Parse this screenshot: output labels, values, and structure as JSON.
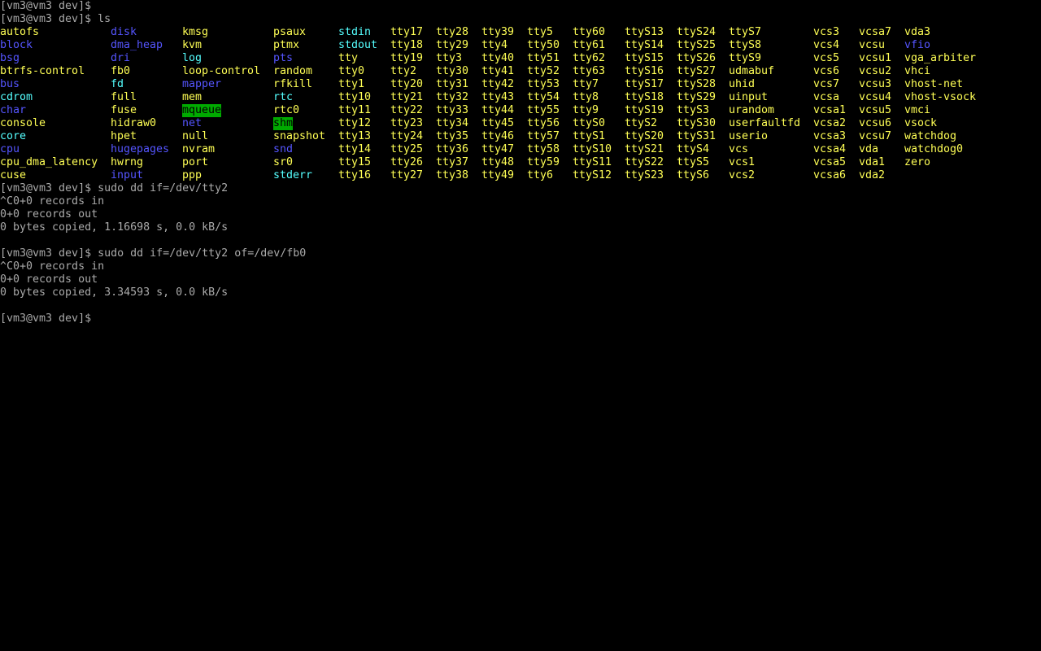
{
  "terminal": {
    "prompt": "[vm3@vm3 dev]$",
    "colors": {
      "background": "#000000",
      "text": "#aaaaaa",
      "device_file": "#ffff55",
      "directory": "#5555ff",
      "symlink": "#55ffff",
      "sticky_dir_highlight": "#00aa00"
    },
    "lines_top": [
      "[vm3@vm3 dev]$",
      "[vm3@vm3 dev]$ ls"
    ],
    "ls_columns": [
      [
        {
          "name": "autofs",
          "kind": "file"
        },
        {
          "name": "block",
          "kind": "dir"
        },
        {
          "name": "bsg",
          "kind": "dir"
        },
        {
          "name": "btrfs-control",
          "kind": "file"
        },
        {
          "name": "bus",
          "kind": "dir"
        },
        {
          "name": "cdrom",
          "kind": "link"
        },
        {
          "name": "char",
          "kind": "dir"
        },
        {
          "name": "console",
          "kind": "file"
        },
        {
          "name": "core",
          "kind": "link"
        },
        {
          "name": "cpu",
          "kind": "dir"
        },
        {
          "name": "cpu_dma_latency",
          "kind": "file"
        },
        {
          "name": "cuse",
          "kind": "file"
        }
      ],
      [
        {
          "name": "disk",
          "kind": "dir"
        },
        {
          "name": "dma_heap",
          "kind": "dir"
        },
        {
          "name": "dri",
          "kind": "dir"
        },
        {
          "name": "fb0",
          "kind": "file"
        },
        {
          "name": "fd",
          "kind": "link"
        },
        {
          "name": "full",
          "kind": "file"
        },
        {
          "name": "fuse",
          "kind": "file"
        },
        {
          "name": "hidraw0",
          "kind": "file"
        },
        {
          "name": "hpet",
          "kind": "file"
        },
        {
          "name": "hugepages",
          "kind": "dir"
        },
        {
          "name": "hwrng",
          "kind": "file"
        },
        {
          "name": "input",
          "kind": "dir"
        }
      ],
      [
        {
          "name": "kmsg",
          "kind": "file"
        },
        {
          "name": "kvm",
          "kind": "file"
        },
        {
          "name": "log",
          "kind": "link"
        },
        {
          "name": "loop-control",
          "kind": "file"
        },
        {
          "name": "mapper",
          "kind": "dir"
        },
        {
          "name": "mem",
          "kind": "file"
        },
        {
          "name": "mqueue",
          "kind": "sticky"
        },
        {
          "name": "net",
          "kind": "dir"
        },
        {
          "name": "null",
          "kind": "file"
        },
        {
          "name": "nvram",
          "kind": "file"
        },
        {
          "name": "port",
          "kind": "file"
        },
        {
          "name": "ppp",
          "kind": "file"
        }
      ],
      [
        {
          "name": "psaux",
          "kind": "file"
        },
        {
          "name": "ptmx",
          "kind": "file"
        },
        {
          "name": "pts",
          "kind": "dir"
        },
        {
          "name": "random",
          "kind": "file"
        },
        {
          "name": "rfkill",
          "kind": "file"
        },
        {
          "name": "rtc",
          "kind": "link"
        },
        {
          "name": "rtc0",
          "kind": "file"
        },
        {
          "name": "shm",
          "kind": "sticky"
        },
        {
          "name": "snapshot",
          "kind": "file"
        },
        {
          "name": "snd",
          "kind": "dir"
        },
        {
          "name": "sr0",
          "kind": "file"
        },
        {
          "name": "stderr",
          "kind": "link"
        }
      ],
      [
        {
          "name": "stdin",
          "kind": "link"
        },
        {
          "name": "stdout",
          "kind": "link"
        },
        {
          "name": "tty",
          "kind": "file"
        },
        {
          "name": "tty0",
          "kind": "file"
        },
        {
          "name": "tty1",
          "kind": "file"
        },
        {
          "name": "tty10",
          "kind": "file"
        },
        {
          "name": "tty11",
          "kind": "file"
        },
        {
          "name": "tty12",
          "kind": "file"
        },
        {
          "name": "tty13",
          "kind": "file"
        },
        {
          "name": "tty14",
          "kind": "file"
        },
        {
          "name": "tty15",
          "kind": "file"
        },
        {
          "name": "tty16",
          "kind": "file"
        }
      ],
      [
        {
          "name": "tty17",
          "kind": "file"
        },
        {
          "name": "tty18",
          "kind": "file"
        },
        {
          "name": "tty19",
          "kind": "file"
        },
        {
          "name": "tty2",
          "kind": "file"
        },
        {
          "name": "tty20",
          "kind": "file"
        },
        {
          "name": "tty21",
          "kind": "file"
        },
        {
          "name": "tty22",
          "kind": "file"
        },
        {
          "name": "tty23",
          "kind": "file"
        },
        {
          "name": "tty24",
          "kind": "file"
        },
        {
          "name": "tty25",
          "kind": "file"
        },
        {
          "name": "tty26",
          "kind": "file"
        },
        {
          "name": "tty27",
          "kind": "file"
        }
      ],
      [
        {
          "name": "tty28",
          "kind": "file"
        },
        {
          "name": "tty29",
          "kind": "file"
        },
        {
          "name": "tty3",
          "kind": "file"
        },
        {
          "name": "tty30",
          "kind": "file"
        },
        {
          "name": "tty31",
          "kind": "file"
        },
        {
          "name": "tty32",
          "kind": "file"
        },
        {
          "name": "tty33",
          "kind": "file"
        },
        {
          "name": "tty34",
          "kind": "file"
        },
        {
          "name": "tty35",
          "kind": "file"
        },
        {
          "name": "tty36",
          "kind": "file"
        },
        {
          "name": "tty37",
          "kind": "file"
        },
        {
          "name": "tty38",
          "kind": "file"
        }
      ],
      [
        {
          "name": "tty39",
          "kind": "file"
        },
        {
          "name": "tty4",
          "kind": "file"
        },
        {
          "name": "tty40",
          "kind": "file"
        },
        {
          "name": "tty41",
          "kind": "file"
        },
        {
          "name": "tty42",
          "kind": "file"
        },
        {
          "name": "tty43",
          "kind": "file"
        },
        {
          "name": "tty44",
          "kind": "file"
        },
        {
          "name": "tty45",
          "kind": "file"
        },
        {
          "name": "tty46",
          "kind": "file"
        },
        {
          "name": "tty47",
          "kind": "file"
        },
        {
          "name": "tty48",
          "kind": "file"
        },
        {
          "name": "tty49",
          "kind": "file"
        }
      ],
      [
        {
          "name": "tty5",
          "kind": "file"
        },
        {
          "name": "tty50",
          "kind": "file"
        },
        {
          "name": "tty51",
          "kind": "file"
        },
        {
          "name": "tty52",
          "kind": "file"
        },
        {
          "name": "tty53",
          "kind": "file"
        },
        {
          "name": "tty54",
          "kind": "file"
        },
        {
          "name": "tty55",
          "kind": "file"
        },
        {
          "name": "tty56",
          "kind": "file"
        },
        {
          "name": "tty57",
          "kind": "file"
        },
        {
          "name": "tty58",
          "kind": "file"
        },
        {
          "name": "tty59",
          "kind": "file"
        },
        {
          "name": "tty6",
          "kind": "file"
        }
      ],
      [
        {
          "name": "tty60",
          "kind": "file"
        },
        {
          "name": "tty61",
          "kind": "file"
        },
        {
          "name": "tty62",
          "kind": "file"
        },
        {
          "name": "tty63",
          "kind": "file"
        },
        {
          "name": "tty7",
          "kind": "file"
        },
        {
          "name": "tty8",
          "kind": "file"
        },
        {
          "name": "tty9",
          "kind": "file"
        },
        {
          "name": "ttyS0",
          "kind": "file"
        },
        {
          "name": "ttyS1",
          "kind": "file"
        },
        {
          "name": "ttyS10",
          "kind": "file"
        },
        {
          "name": "ttyS11",
          "kind": "file"
        },
        {
          "name": "ttyS12",
          "kind": "file"
        }
      ],
      [
        {
          "name": "ttyS13",
          "kind": "file"
        },
        {
          "name": "ttyS14",
          "kind": "file"
        },
        {
          "name": "ttyS15",
          "kind": "file"
        },
        {
          "name": "ttyS16",
          "kind": "file"
        },
        {
          "name": "ttyS17",
          "kind": "file"
        },
        {
          "name": "ttyS18",
          "kind": "file"
        },
        {
          "name": "ttyS19",
          "kind": "file"
        },
        {
          "name": "ttyS2",
          "kind": "file"
        },
        {
          "name": "ttyS20",
          "kind": "file"
        },
        {
          "name": "ttyS21",
          "kind": "file"
        },
        {
          "name": "ttyS22",
          "kind": "file"
        },
        {
          "name": "ttyS23",
          "kind": "file"
        }
      ],
      [
        {
          "name": "ttyS24",
          "kind": "file"
        },
        {
          "name": "ttyS25",
          "kind": "file"
        },
        {
          "name": "ttyS26",
          "kind": "file"
        },
        {
          "name": "ttyS27",
          "kind": "file"
        },
        {
          "name": "ttyS28",
          "kind": "file"
        },
        {
          "name": "ttyS29",
          "kind": "file"
        },
        {
          "name": "ttyS3",
          "kind": "file"
        },
        {
          "name": "ttyS30",
          "kind": "file"
        },
        {
          "name": "ttyS31",
          "kind": "file"
        },
        {
          "name": "ttyS4",
          "kind": "file"
        },
        {
          "name": "ttyS5",
          "kind": "file"
        },
        {
          "name": "ttyS6",
          "kind": "file"
        }
      ],
      [
        {
          "name": "ttyS7",
          "kind": "file"
        },
        {
          "name": "ttyS8",
          "kind": "file"
        },
        {
          "name": "ttyS9",
          "kind": "file"
        },
        {
          "name": "udmabuf",
          "kind": "file"
        },
        {
          "name": "uhid",
          "kind": "file"
        },
        {
          "name": "uinput",
          "kind": "file"
        },
        {
          "name": "urandom",
          "kind": "file"
        },
        {
          "name": "userfaultfd",
          "kind": "file"
        },
        {
          "name": "userio",
          "kind": "file"
        },
        {
          "name": "vcs",
          "kind": "file"
        },
        {
          "name": "vcs1",
          "kind": "file"
        },
        {
          "name": "vcs2",
          "kind": "file"
        }
      ],
      [
        {
          "name": "vcs3",
          "kind": "file"
        },
        {
          "name": "vcs4",
          "kind": "file"
        },
        {
          "name": "vcs5",
          "kind": "file"
        },
        {
          "name": "vcs6",
          "kind": "file"
        },
        {
          "name": "vcs7",
          "kind": "file"
        },
        {
          "name": "vcsa",
          "kind": "file"
        },
        {
          "name": "vcsa1",
          "kind": "file"
        },
        {
          "name": "vcsa2",
          "kind": "file"
        },
        {
          "name": "vcsa3",
          "kind": "file"
        },
        {
          "name": "vcsa4",
          "kind": "file"
        },
        {
          "name": "vcsa5",
          "kind": "file"
        },
        {
          "name": "vcsa6",
          "kind": "file"
        }
      ],
      [
        {
          "name": "vcsa7",
          "kind": "file"
        },
        {
          "name": "vcsu",
          "kind": "file"
        },
        {
          "name": "vcsu1",
          "kind": "file"
        },
        {
          "name": "vcsu2",
          "kind": "file"
        },
        {
          "name": "vcsu3",
          "kind": "file"
        },
        {
          "name": "vcsu4",
          "kind": "file"
        },
        {
          "name": "vcsu5",
          "kind": "file"
        },
        {
          "name": "vcsu6",
          "kind": "file"
        },
        {
          "name": "vcsu7",
          "kind": "file"
        },
        {
          "name": "vda",
          "kind": "file"
        },
        {
          "name": "vda1",
          "kind": "file"
        },
        {
          "name": "vda2",
          "kind": "file"
        }
      ],
      [
        {
          "name": "vda3",
          "kind": "file"
        },
        {
          "name": "vfio",
          "kind": "dir"
        },
        {
          "name": "vga_arbiter",
          "kind": "file"
        },
        {
          "name": "vhci",
          "kind": "file"
        },
        {
          "name": "vhost-net",
          "kind": "file"
        },
        {
          "name": "vhost-vsock",
          "kind": "file"
        },
        {
          "name": "vmci",
          "kind": "file"
        },
        {
          "name": "vsock",
          "kind": "file"
        },
        {
          "name": "watchdog",
          "kind": "file"
        },
        {
          "name": "watchdog0",
          "kind": "file"
        },
        {
          "name": "zero",
          "kind": "file"
        }
      ]
    ],
    "lines_bottom": [
      "[vm3@vm3 dev]$ sudo dd if=/dev/tty2",
      "^C0+0 records in",
      "0+0 records out",
      "0 bytes copied, 1.16698 s, 0.0 kB/s",
      "",
      "[vm3@vm3 dev]$ sudo dd if=/dev/tty2 of=/dev/fb0",
      "^C0+0 records in",
      "0+0 records out",
      "0 bytes copied, 3.34593 s, 0.0 kB/s",
      "",
      "[vm3@vm3 dev]$"
    ]
  }
}
